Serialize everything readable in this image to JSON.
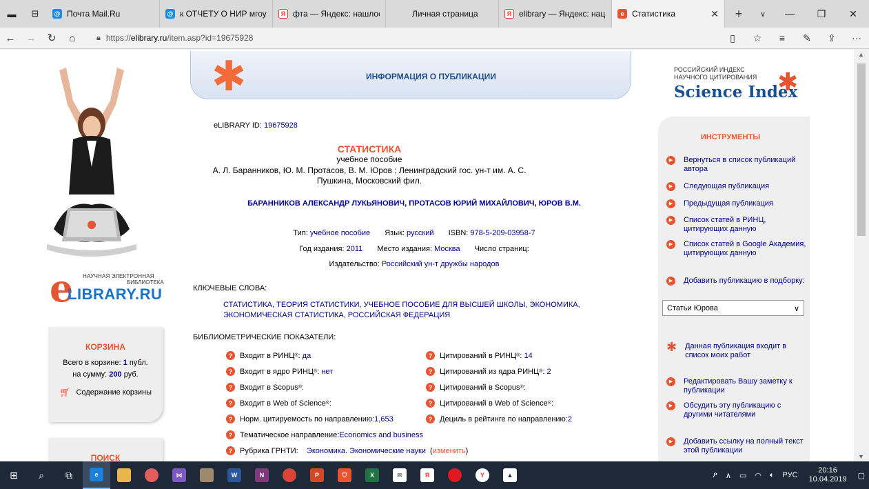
{
  "browser": {
    "tabs": [
      {
        "title": "Почта Mail.Ru",
        "icon_color": "#168de2",
        "active": false
      },
      {
        "title": "к ОТЧЕТУ О НИР мгоу",
        "icon_color": "#168de2",
        "active": false
      },
      {
        "title": "фта — Яндекс: нашлос",
        "icon_color": "#f33",
        "active": false
      },
      {
        "title": "Личная страница",
        "icon_color": "",
        "active": false
      },
      {
        "title": "elibrary — Яндекс: нац",
        "icon_color": "#f33",
        "active": false
      },
      {
        "title": "Статистика",
        "icon_color": "#e8542f",
        "active": true
      }
    ],
    "url_prefix": "https://",
    "url_host": "elibrary.ru",
    "url_path": "/item.asp?id=19675928"
  },
  "left": {
    "logo_line1": "НАУЧНАЯ ЭЛЕКТРОННАЯ",
    "logo_line2": "БИБЛИОТЕКА",
    "logo_brand": "LIBRARY.RU",
    "cart": {
      "title": "КОРЗИНА",
      "total_prefix": "Всего в корзине: ",
      "total_value": "1",
      "total_suffix": " публ.",
      "sum_prefix": "на сумму: ",
      "sum_value": "200",
      "sum_suffix": " руб.",
      "content_label": "Содержание корзины"
    },
    "search_title": "ПОИСК"
  },
  "banner_title": "ИНФОРМАЦИЯ О ПУБЛИКАЦИИ",
  "publication": {
    "id_label": "eLIBRARY ID: ",
    "id_value": "19675928",
    "title": "СТАТИСТИКА",
    "subtitle": "учебное пособие",
    "responsibility": "А. Л. Баранников, Ю. М. Протасов, В. М. Юров ; Ленинградский гос. ун-т им. А. С. Пушкина, Московский фил.",
    "authors": [
      "БАРАННИКОВ АЛЕКСАНДР ЛУКЬЯНОВИЧ",
      "ПРОТАСОВ ЮРИЙ МИХАЙЛОВИЧ",
      "ЮРОВ В.М."
    ],
    "type_label": "Тип: ",
    "type_value": "учебное пособие",
    "lang_label": "Язык: ",
    "lang_value": "русский",
    "isbn_label": "ISBN: ",
    "isbn_value": "978-5-209-03958-7",
    "year_label": "Год издания: ",
    "year_value": "2011",
    "place_label": "Место издания: ",
    "place_value": "Москва",
    "pages_label": "Число страниц:",
    "publisher_label": "Издательство: ",
    "publisher_value": "Российский ун-т дружбы народов",
    "keywords_heading": "КЛЮЧЕВЫЕ СЛОВА:",
    "keywords": "СТАТИСТИКА, ТЕОРИЯ СТАТИСТИКИ, УЧЕБНОЕ ПОСОБИЕ ДЛЯ ВЫСШЕЙ ШКОЛЫ, ЭКОНОМИКА, ЭКОНОМИЧЕСКАЯ СТАТИСТИКА, РОССИЙСКАЯ ФЕДЕРАЦИЯ",
    "biblio_heading": "БИБЛИОМЕТРИЧЕСКИЕ ПОКАЗАТЕЛИ:"
  },
  "biblio": {
    "rinc_label": "Входит в РИНЦ",
    "rinc_value": "да",
    "core_label": "Входит в ядро РИНЦ",
    "core_value": "нет",
    "scopus_label": "Входит в Scopus",
    "wos_label": "Входит в Web of Science",
    "norm_label": "Норм. цитируемость по направлению: ",
    "norm_value": "1,653",
    "topic_label": "Тематическое направление: ",
    "topic_value": "Economics and business",
    "grnti_label": "Рубрика ГРНТИ:",
    "grnti_value": "Экономика. Экономические науки",
    "grnti_change": "изменить",
    "cit_rinc_label": "Цитирований в РИНЦ",
    "cit_rinc_value": "14",
    "cit_core_label": "Цитирований из ядра РИНЦ",
    "cit_core_value": "2",
    "cit_scopus_label": "Цитирований в Scopus",
    "cit_wos_label": "Цитирований в Web of Science",
    "decile_label": "Дециль в рейтинге по направлению: ",
    "decile_value": "2"
  },
  "right": {
    "si_line1": "РОССИЙСКИЙ ИНДЕКС",
    "si_line2": "НАУЧНОГО ЦИТИРОВАНИЯ",
    "si_brand": "Science Index",
    "tools_title": "ИНСТРУМЕНТЫ",
    "tools": [
      "Вернуться в список публикаций автора",
      "Следующая публикация",
      "Предыдущая публикация",
      "Список статей в РИНЦ, цитирующих данную",
      "Список статей в Google Академия, цитирующих данную",
      "Добавить публикацию в подборку:"
    ],
    "collection_selected": "Статьи Юрова",
    "my_works": "Данная публикация входит в список моих работ",
    "tools2": [
      "Редактировать Вашу заметку к публикации",
      "Обсудить эту публикацию с другими читателями",
      "Добавить ссылку на полный текст этой публикации"
    ]
  },
  "taskbar": {
    "lang": "РУС",
    "time": "20:16",
    "date": "10.04.2019"
  }
}
